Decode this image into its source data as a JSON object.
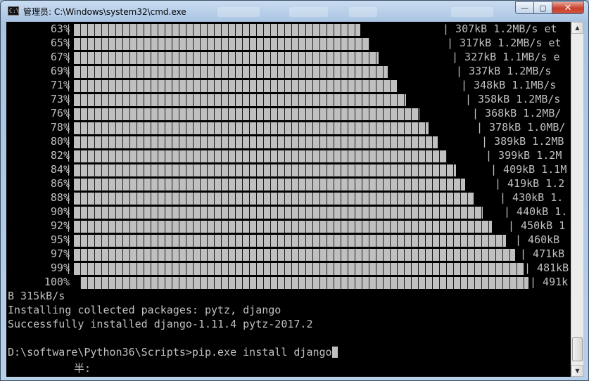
{
  "window": {
    "title": "管理员: C:\\Windows\\system32\\cmd.exe",
    "app_icon_text": "C:\\",
    "controls": {
      "minimize": "—",
      "maximize": "▢",
      "close": "✕"
    }
  },
  "console": {
    "progress_rows": [
      {
        "percent": "63%",
        "rate": "| 307kB 1.2MB/s et"
      },
      {
        "percent": "65%",
        "rate": "| 317kB 1.2MB/s et"
      },
      {
        "percent": "67%",
        "rate": "| 327kB 1.1MB/s e"
      },
      {
        "percent": "69%",
        "rate": "| 337kB 1.2MB/s"
      },
      {
        "percent": "71%",
        "rate": "| 348kB 1.1MB/s"
      },
      {
        "percent": "73%",
        "rate": "| 358kB 1.2MB/s"
      },
      {
        "percent": "76%",
        "rate": "| 368kB 1.2MB/"
      },
      {
        "percent": "78%",
        "rate": "| 378kB 1.0MB/"
      },
      {
        "percent": "80%",
        "rate": "| 389kB 1.2MB"
      },
      {
        "percent": "82%",
        "rate": "| 399kB 1.2M"
      },
      {
        "percent": "84%",
        "rate": "| 409kB 1.1M"
      },
      {
        "percent": "86%",
        "rate": "| 419kB 1.2"
      },
      {
        "percent": "88%",
        "rate": "| 430kB 1."
      },
      {
        "percent": "90%",
        "rate": "| 440kB 1."
      },
      {
        "percent": "92%",
        "rate": "| 450kB 1"
      },
      {
        "percent": "95%",
        "rate": "| 460kB"
      },
      {
        "percent": "97%",
        "rate": "| 471kB"
      },
      {
        "percent": "99%",
        "rate": "| 481kB"
      },
      {
        "percent": "100%",
        "rate": "| 491k"
      }
    ],
    "wrap_line": "B 315kB/s",
    "installing_line": "Installing collected packages: pytz, django",
    "success_line": "Successfully installed django-1.11.4 pytz-2017.2",
    "prompt_line": "D:\\software\\Python36\\Scripts>pip.exe install django",
    "ime_indicator": "半:"
  },
  "scrollbar": {
    "up_arrow": "▲",
    "down_arrow": "▼"
  }
}
